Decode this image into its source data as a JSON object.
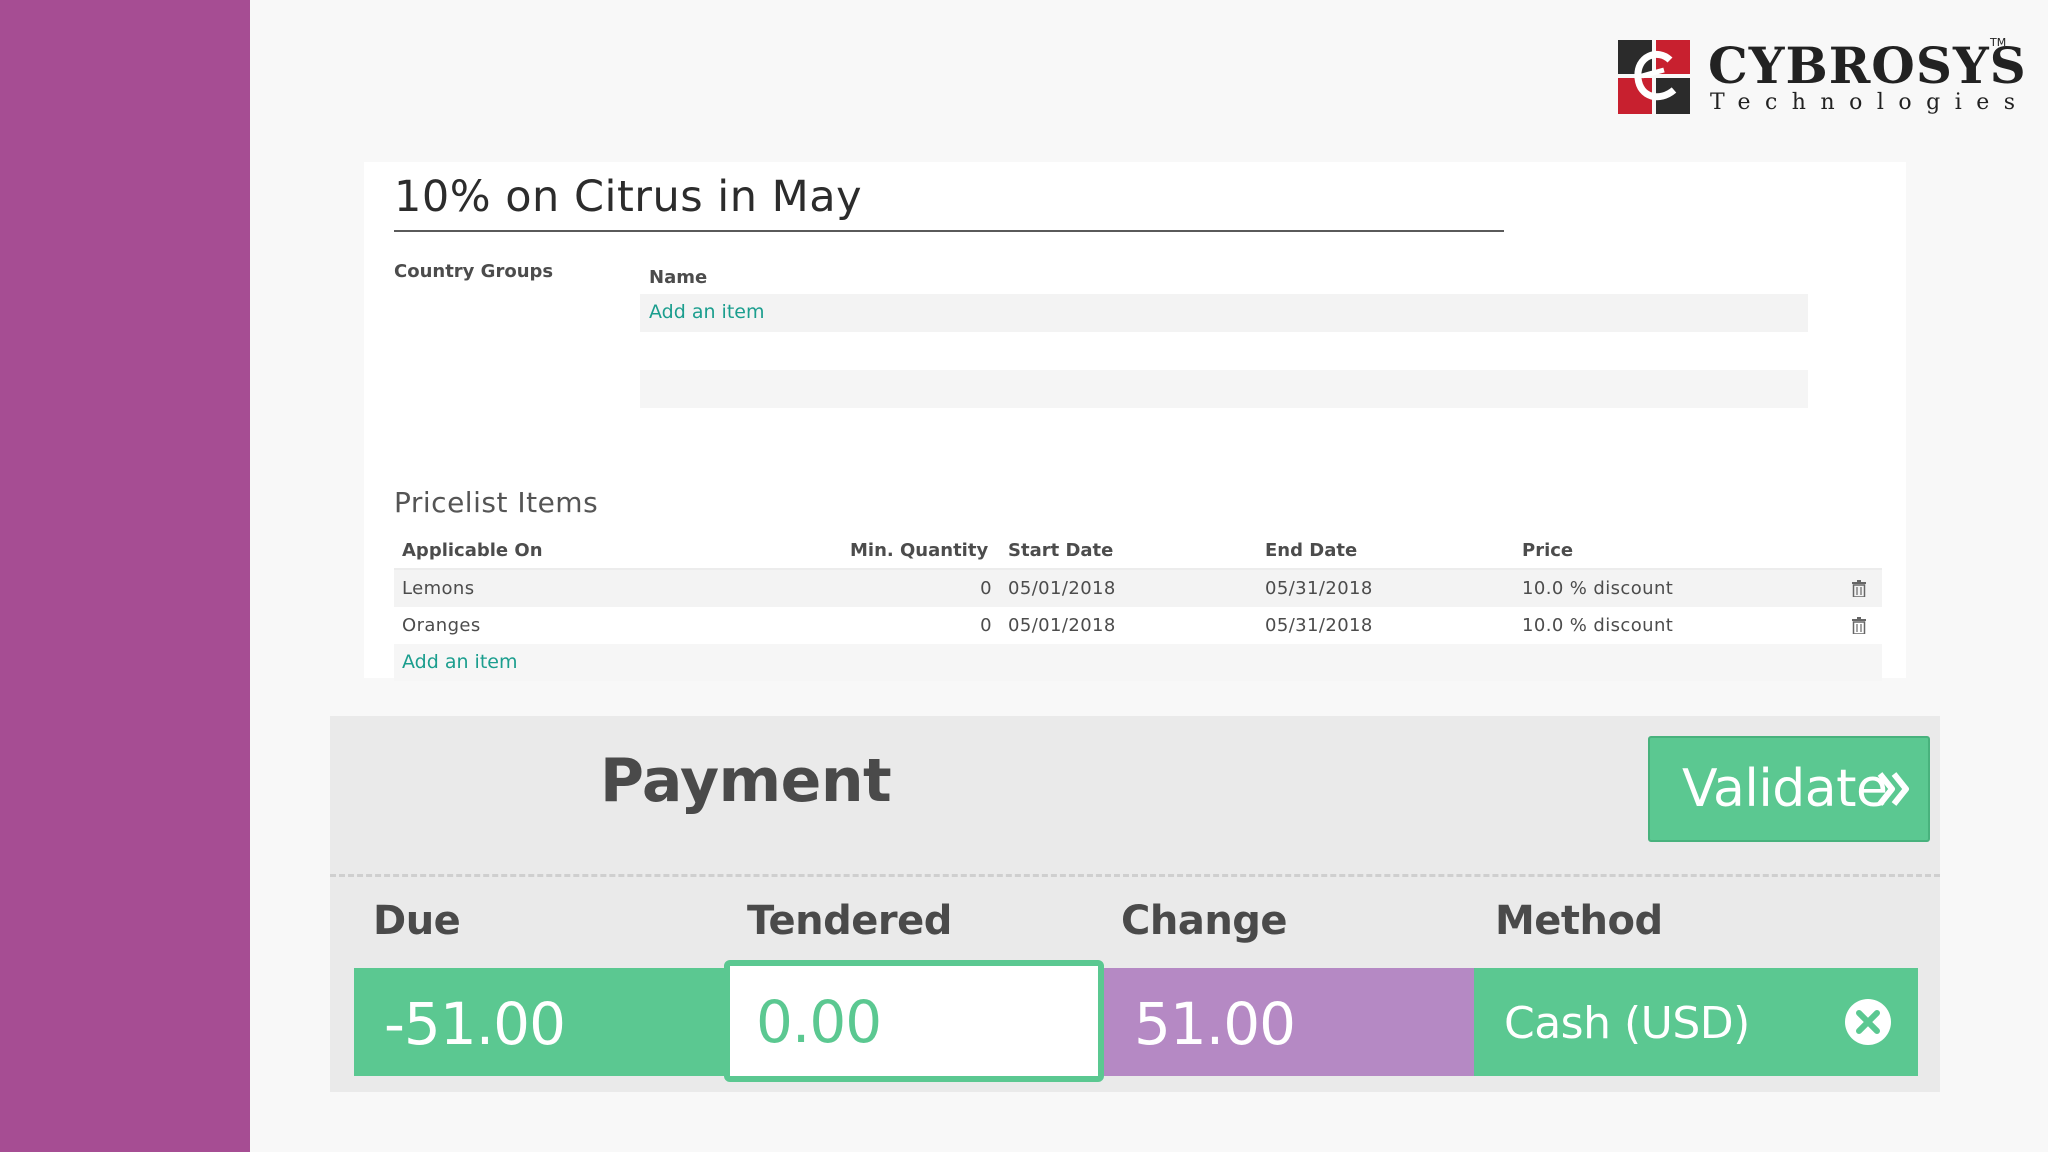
{
  "brand": {
    "name": "CYBROSYS",
    "trademark": "TM",
    "tagline": "Technologies",
    "colors": {
      "accent_bar": "#a64d93",
      "logo_red": "#c8202f",
      "logo_dark": "#2b2b2b"
    }
  },
  "pricelist": {
    "title": "10% on Citrus in May",
    "country_groups": {
      "label": "Country Groups",
      "column_name": "Name",
      "add_item": "Add an item"
    },
    "items_section": {
      "title": "Pricelist Items",
      "columns": {
        "applicable_on": "Applicable On",
        "min_quantity": "Min. Quantity",
        "start_date": "Start Date",
        "end_date": "End Date",
        "price": "Price"
      },
      "rows": [
        {
          "applicable_on": "Lemons",
          "min_quantity": "0",
          "start_date": "05/01/2018",
          "end_date": "05/31/2018",
          "price": "10.0 % discount"
        },
        {
          "applicable_on": "Oranges",
          "min_quantity": "0",
          "start_date": "05/01/2018",
          "end_date": "05/31/2018",
          "price": "10.0 % discount"
        }
      ],
      "add_item": "Add an item"
    },
    "link_color": "#1b9e8e"
  },
  "payment": {
    "title": "Payment",
    "validate_label": "Validate",
    "columns": {
      "due": "Due",
      "tendered": "Tendered",
      "change": "Change",
      "method": "Method"
    },
    "line": {
      "due": "-51.00",
      "tendered": "0.00",
      "change": "51.00",
      "method": "Cash (USD)"
    },
    "colors": {
      "green": "#5bc891",
      "purple": "#b589c4"
    }
  }
}
